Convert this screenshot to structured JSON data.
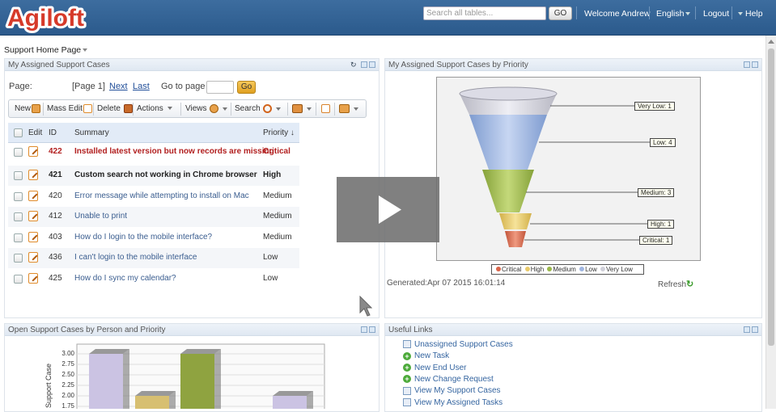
{
  "header": {
    "logo_text": "Agiloft",
    "search_placeholder": "Search all tables...",
    "go_label": "GO",
    "welcome": "Welcome Andrew",
    "language": "English",
    "logout": "Logout",
    "help": "Help"
  },
  "page": {
    "title": "Support Home Page"
  },
  "cases_panel": {
    "title": "My Assigned Support Cases",
    "pager_label": "Page:",
    "page_indicator": "[Page 1]",
    "next": "Next",
    "last": "Last",
    "goto_label": "Go to page",
    "goto_button": "Go",
    "toolbar": {
      "new": "New",
      "mass_edit": "Mass Edit",
      "delete": "Delete",
      "actions": "Actions",
      "views": "Views",
      "search": "Search"
    },
    "columns": {
      "edit": "Edit",
      "id": "ID",
      "summary": "Summary",
      "priority": "Priority ↓"
    },
    "rows": [
      {
        "id": "422",
        "summary": "Installed latest version but now records are missing",
        "priority": "Critical"
      },
      {
        "id": "421",
        "summary": "Custom search not working in Chrome browser",
        "priority": "High"
      },
      {
        "id": "420",
        "summary": "Error message while attempting to install on Mac",
        "priority": "Medium"
      },
      {
        "id": "412",
        "summary": "Unable to print",
        "priority": "Medium"
      },
      {
        "id": "403",
        "summary": "How do I login to the mobile interface?",
        "priority": "Medium"
      },
      {
        "id": "436",
        "summary": "I can't login to the mobile interface",
        "priority": "Low"
      },
      {
        "id": "425",
        "summary": "How do I sync my calendar?",
        "priority": "Low"
      }
    ]
  },
  "funnel_panel": {
    "title": "My Assigned Support Cases by Priority",
    "labels": [
      "Very Low: 1",
      "Low: 4",
      "Medium: 3",
      "High: 1",
      "Critical: 1"
    ],
    "legend": [
      "Critical",
      "High",
      "Medium",
      "Low",
      "Very Low"
    ],
    "legend_colors": [
      "#d9654a",
      "#e8c96a",
      "#9ab74a",
      "#9fb5e0",
      "#cfcfd8"
    ],
    "generated": "Generated:Apr 07 2015 16:01:14",
    "refresh": "Refresh"
  },
  "chart_data": {
    "type": "bar",
    "categories": [
      "",
      "",
      "",
      "",
      ""
    ],
    "series": [
      {
        "values": [
          2.0,
          2.0,
          2.0,
          0,
          1.75
        ]
      },
      {
        "values": [
          1.0,
          0,
          1.0,
          0,
          1.0
        ]
      }
    ],
    "ylabel": "Support Cases",
    "yticks": [
      "3.00",
      "2.75",
      "2.50",
      "2.25",
      "2.00",
      "1.75"
    ],
    "ylim": [
      1.75,
      3.0
    ]
  },
  "bar_panel": {
    "title": "Open Support Cases by Person and Priority"
  },
  "links_panel": {
    "title": "Useful Links",
    "items": [
      {
        "label": "Unassigned Support Cases",
        "icon": "doc"
      },
      {
        "label": "New Task",
        "icon": "plus"
      },
      {
        "label": "New End User",
        "icon": "plus"
      },
      {
        "label": "New Change Request",
        "icon": "plus"
      },
      {
        "label": "View My Support Cases",
        "icon": "doc"
      },
      {
        "label": "View My Assigned Tasks",
        "icon": "doc"
      }
    ]
  }
}
